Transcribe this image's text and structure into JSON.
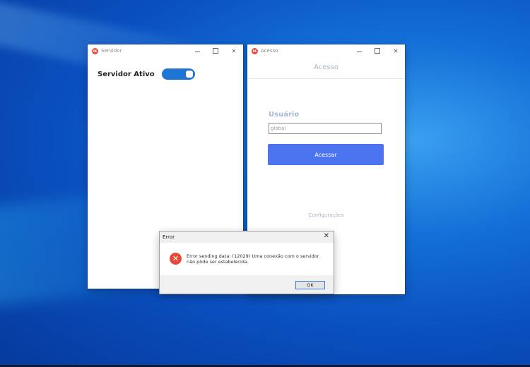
{
  "servidor_window": {
    "title": "Servidor",
    "icon": "app-logo-icon",
    "toggle_label": "Servidor Ativo",
    "toggle_on": true,
    "toggle_color": "#1e76d4"
  },
  "acesso_window": {
    "title": "Acesso",
    "header": "Acesso",
    "user_label": "Usuário",
    "user_value": "global",
    "submit_label": "Acessar",
    "config_link": "Configurações",
    "accent_color": "#4c73f0"
  },
  "error_dialog": {
    "title": "Error",
    "message": "Error sending data: (12029) Uma conexão com o servidor não pôde ser estabelecida.",
    "ok_label": "OK",
    "icon": "error-icon"
  }
}
